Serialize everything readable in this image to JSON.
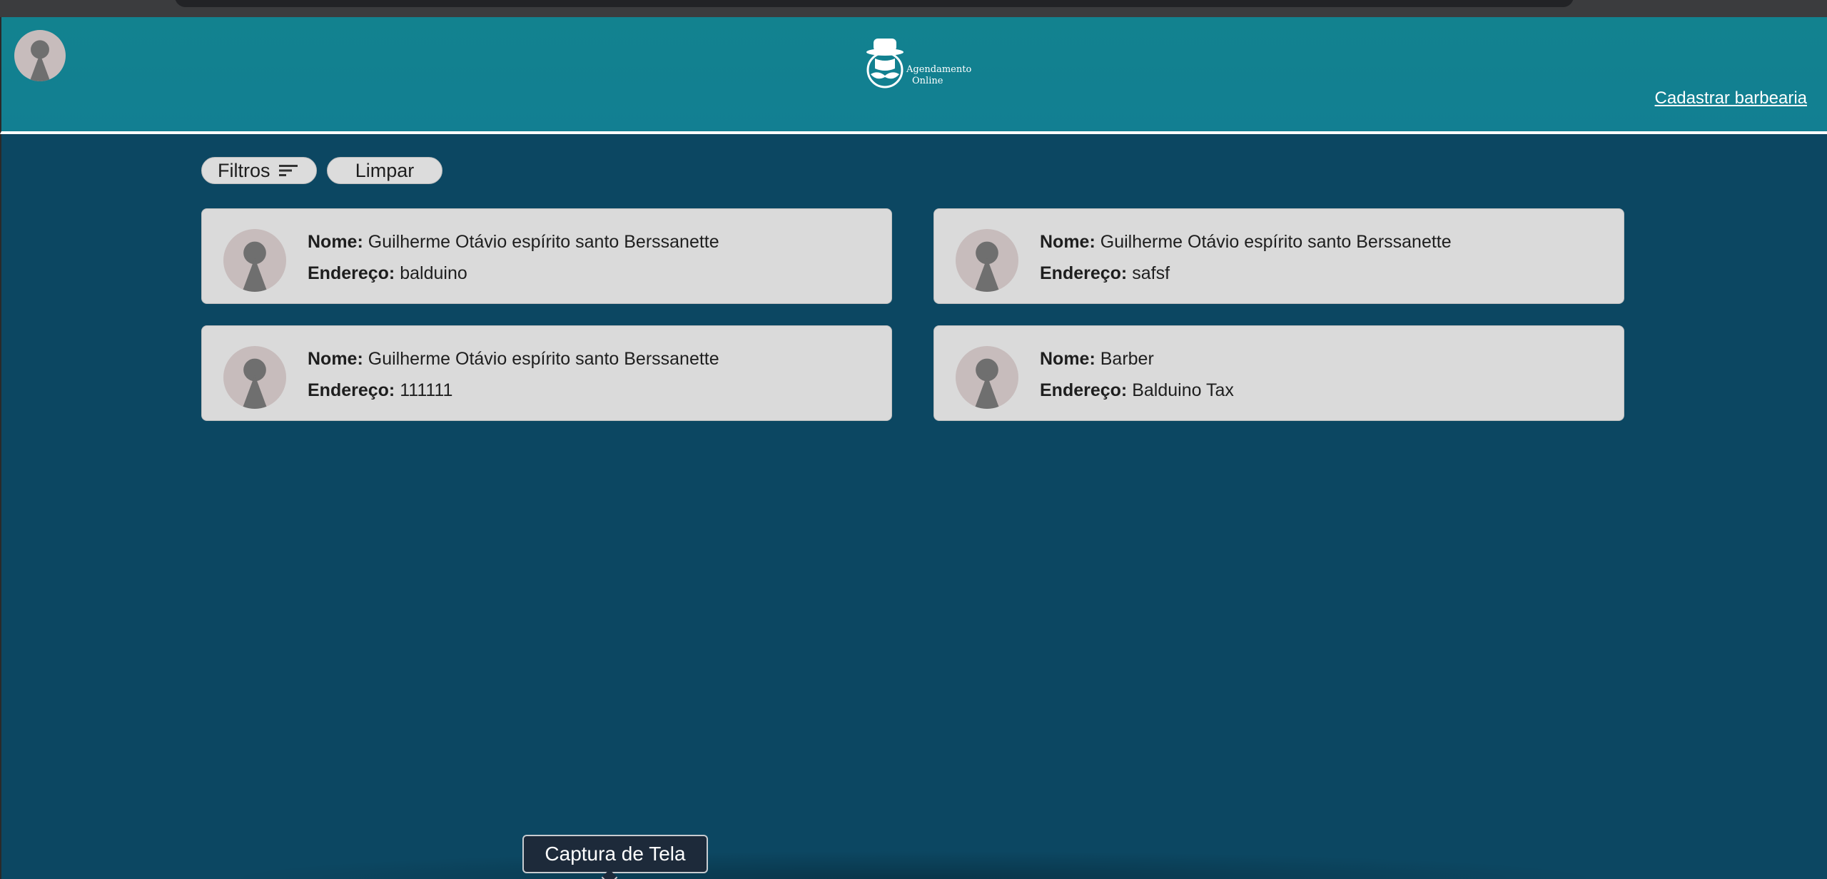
{
  "header": {
    "logo_line1": "Agendamento",
    "logo_line2": "Online",
    "register_link": "Cadastrar barbearia"
  },
  "filters": {
    "filter_label": "Filtros",
    "clear_label": "Limpar"
  },
  "labels": {
    "name": "Nome:",
    "address": "Endereço:"
  },
  "barbershops": [
    {
      "name": "Guilherme Otávio espírito santo Berssanette",
      "address": "balduino"
    },
    {
      "name": "Guilherme Otávio espírito santo Berssanette",
      "address": "safsf"
    },
    {
      "name": "Guilherme Otávio espírito santo Berssanette",
      "address": "111111"
    },
    {
      "name": "Barber",
      "address": "Balduino Tax"
    }
  ],
  "tooltip": {
    "text": "Captura de Tela"
  },
  "colors": {
    "header": "#12828f",
    "page_background": "#0c4762",
    "card_background": "#dadada",
    "avatar_background": "#c7bcbc"
  },
  "icons": {
    "user": "person-silhouette-icon",
    "filter": "filter-lines-icon",
    "logo": "hat-mustache-logo"
  }
}
